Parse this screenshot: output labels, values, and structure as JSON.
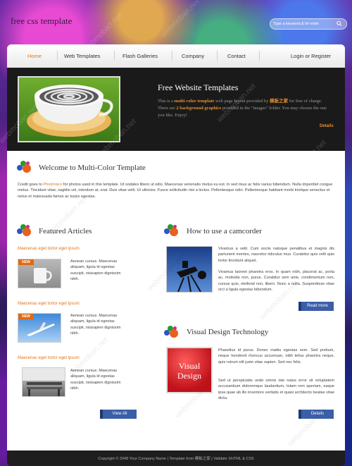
{
  "header": {
    "site_name": "free css template",
    "search_placeholder": "Type a keyword & hit enter"
  },
  "nav": {
    "items": [
      {
        "label": "Home",
        "active": true
      },
      {
        "label": "Web Templates",
        "active": false
      },
      {
        "label": "Flash Galleries",
        "active": false
      },
      {
        "label": "Company",
        "active": false
      },
      {
        "label": "Contact",
        "active": false
      }
    ],
    "login_label": "Login or Register"
  },
  "banner": {
    "title": "Free Website Templates",
    "text_1": "This is a",
    "highlight_1": "multi-color template",
    "text_2": "web page layout provided by",
    "highlight_2": "模板之家",
    "text_3": "for free of charge. There are",
    "highlight_3": "2 background graphics",
    "text_4": "provided in the \"images\" folder. You may choose the one you like. Enjoy!",
    "details_label": "Details"
  },
  "welcome": {
    "title": "Welcome to Multi-Color Template",
    "text_a": "Credit goes to",
    "link": "PhotoVaco",
    "text_b": "for photos used in this template. Ut sodales libero ut odio. Maecenas venenatis metus eu est. In sed risus ac felis varius bibendum. Nulla imperdiet congue metus. Tincidunt vitae, sagittis vel, interdum at, erat. Duis vitae velit. Ut ultricies. Fusce sollicitudin nisi a lectus. Pellentesque odio. Pellentesque habitant morbi tristique senectus et netus et malesuada fames ac turpis egestas."
  },
  "featured": {
    "title": "Featured Articles",
    "badge": "NEW",
    "articles": [
      {
        "title": "Maecenas eget tortor eget ipsum",
        "text": "Aenean cursus. Maecenas aliquam, ligula id egestas suscipit, nisisapien dignissim nibh."
      },
      {
        "title": "Maecenas eget tortor eget ipsum",
        "text": "Aenean cursus. Maecenas aliquam, ligula id egestas suscipit, nisisapien dignissim nibh."
      },
      {
        "title": "Maecenas eget tortor eget ipsum",
        "text": "Aenean cursus. Maecenas aliquam, ligula id egestas suscipit, nisisapien dignissim nibh."
      }
    ],
    "view_all_label": "View All"
  },
  "camcorder": {
    "title": "How to use a camcorder",
    "p1": "Vivamus a velit. Cum sociis natoque penalibus et magnis dis parturient montes, nascetur ridiculus mus. Curabitur quis velit quis tortor tincidunt aliquet.",
    "p2": "Vivamus laoreet pharetra eros. In quam nibh, placerat ac, porta ac, molestie non, purus. Curabitur sem ante, condimentum non, cursus quis, eleifend non, libero. Nunc a nulla. Suspendisse vitae orci a ligula egestas bibendum.",
    "read_more_label": "Read more"
  },
  "visual_design": {
    "title": "Visual Design Technology",
    "image_text_1": "Visual",
    "image_text_2": "Design",
    "p1": "Phasellus id purus. Donec mattis egestas sem. Sed pretium, neque hendrerit rhoncus accumsan, nibh tellus pharetra neque, quis rutrum elit justo vitae sapien. Sed nec felis.",
    "p2": "Sed ut perspiciatis unde omnis iste natus error sit voluptatem accusantium doloremque laudantium, totam rem aperiam, eaque ipsa quae ab illo inventore veritatis et quasi architecto beatae vitae dicta.",
    "details_label": "Details"
  },
  "footer": {
    "text": "Copyright © 2048 Your Company Name | Template from 模板之家 | Validate XHTML & CSS"
  },
  "watermark": "webmoban.net",
  "colors": {
    "accent_orange": "#e0761e",
    "button_blue": "#3a5ea8",
    "banner_bg": "#1a1a1a"
  }
}
